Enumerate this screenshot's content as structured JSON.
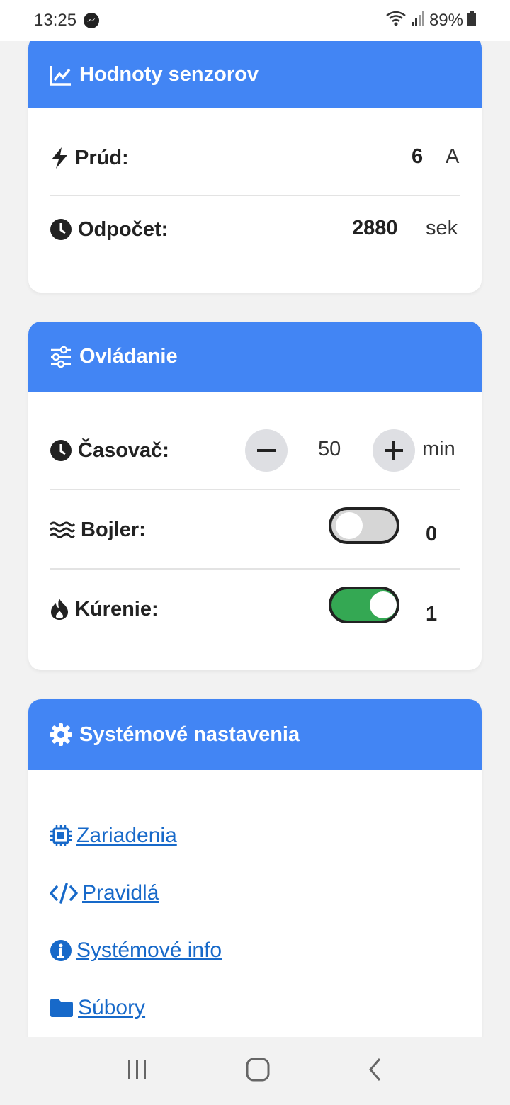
{
  "status_bar": {
    "time": "13:25",
    "battery": "89%"
  },
  "sensors": {
    "title": "Hodnoty senzorov",
    "current": {
      "label": "Prúd:",
      "value": "6",
      "unit": "A"
    },
    "countdown": {
      "label": "Odpočet:",
      "value": "2880",
      "unit": "sek"
    }
  },
  "control": {
    "title": "Ovládanie",
    "timer": {
      "label": "Časovač:",
      "value": "50",
      "unit": "min"
    },
    "boiler": {
      "label": "Bojler:",
      "state": "0"
    },
    "heating": {
      "label": "Kúrenie:",
      "state": "1"
    }
  },
  "settings": {
    "title": "Systémové nastavenia",
    "links": [
      {
        "label": "Zariadenia",
        "icon": "chip-icon"
      },
      {
        "label": "Pravidlá",
        "icon": "code-icon"
      },
      {
        "label": "Systémové info",
        "icon": "info-icon"
      },
      {
        "label": "Súbory",
        "icon": "folder-icon"
      }
    ]
  },
  "colors": {
    "header": "#4285f4",
    "link": "#1769c9",
    "toggle_on": "#34a853",
    "toggle_off": "#d6d6d6"
  }
}
